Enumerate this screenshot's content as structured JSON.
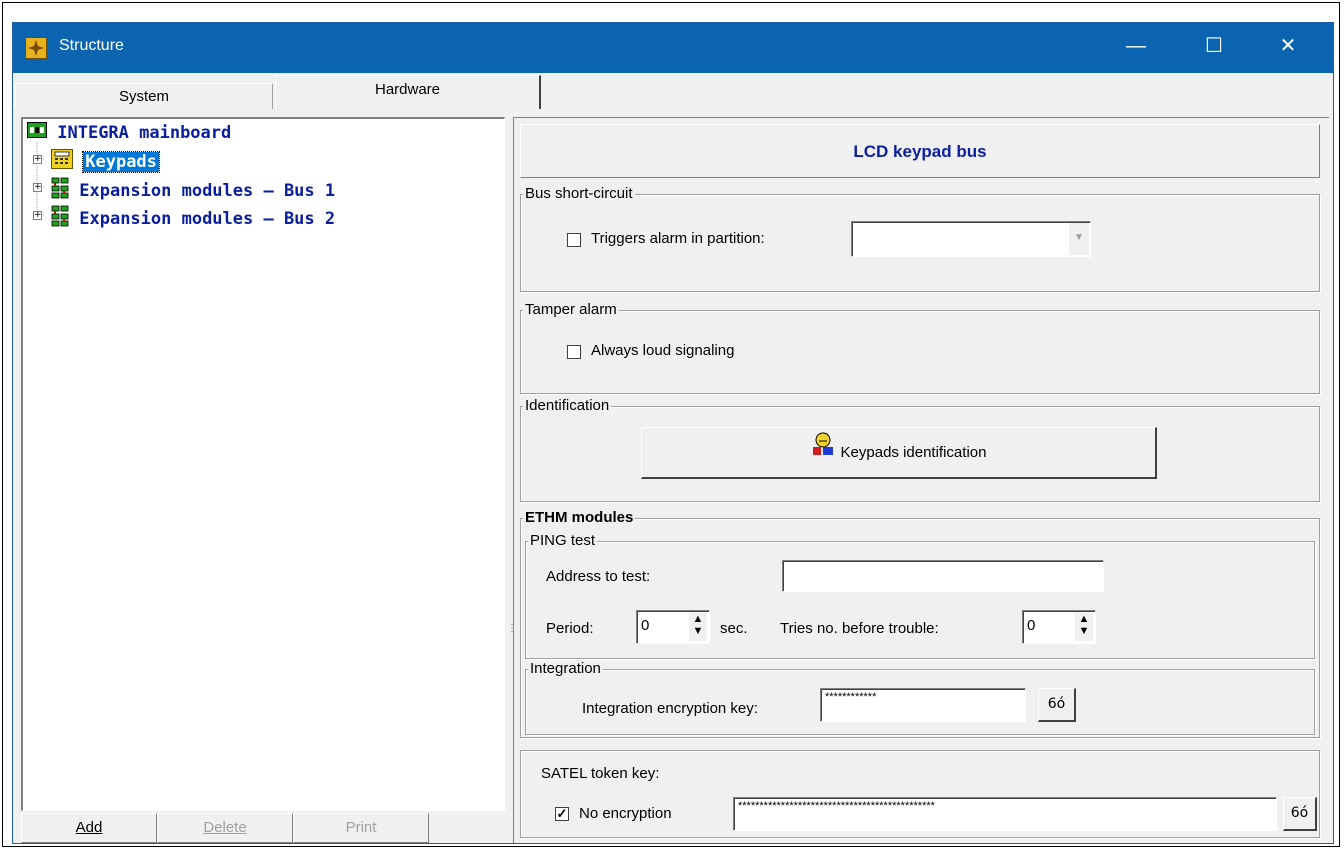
{
  "window": {
    "title": "Structure",
    "controls": {
      "minimize": "—",
      "maximize": "☐",
      "close": "✕"
    }
  },
  "tabs": [
    {
      "label": "System"
    },
    {
      "label": "Hardware"
    }
  ],
  "tree": {
    "root": "INTEGRA mainboard",
    "items": [
      {
        "label": "Keypads"
      },
      {
        "label": "Expansion modules – Bus 1"
      },
      {
        "label": "Expansion modules – Bus 2"
      }
    ]
  },
  "bottom_buttons": {
    "add": "Add",
    "delete": "Delete",
    "print": "Print"
  },
  "panel": {
    "header": "LCD keypad bus",
    "bus_short_circuit": {
      "legend": "Bus short-circuit",
      "checkbox_label": "Triggers alarm in partition:",
      "checked": false,
      "partition_value": ""
    },
    "tamper_alarm": {
      "legend": "Tamper alarm",
      "checkbox_label": "Always loud signaling",
      "checked": false
    },
    "identification": {
      "legend": "Identification",
      "button_label": "Keypads identification"
    },
    "ethm": {
      "legend": "ETHM modules",
      "ping": {
        "legend": "PING test",
        "address_label": "Address to test:",
        "address_value": "",
        "period_label": "Period:",
        "period_value": "0",
        "period_unit": "sec.",
        "tries_label": "Tries no. before trouble:",
        "tries_value": "0"
      },
      "integration": {
        "legend": "Integration",
        "key_label": "Integration encryption key:",
        "key_value": "************"
      }
    },
    "satel": {
      "label": "SATEL token key:",
      "checkbox_label": "No encryption",
      "checked": true,
      "key_value": "**********************************************"
    }
  },
  "colors": {
    "titlebar": "#0a64b0",
    "tree_text": "#0a1ea0",
    "selection": "#0078d7"
  }
}
